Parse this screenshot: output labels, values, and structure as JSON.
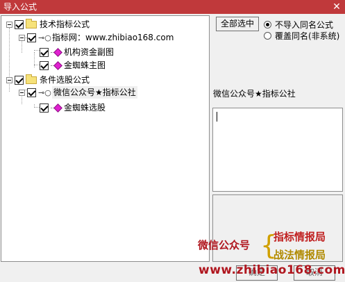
{
  "window": {
    "title": "导入公式",
    "close_glyph": "✕"
  },
  "tree": [
    {
      "label": "技术指标公式",
      "type": "folder",
      "checked": true
    },
    {
      "label": "指标网：www.zhibiao168.com",
      "type": "author",
      "checked": true
    },
    {
      "label": "机构资金副图",
      "type": "formula",
      "checked": true
    },
    {
      "label": "金蜘蛛主图",
      "type": "formula",
      "checked": true
    },
    {
      "label": "条件选股公式",
      "type": "folder",
      "checked": true
    },
    {
      "label": "微信公众号★指标公社",
      "type": "author",
      "checked": true,
      "selected": true
    },
    {
      "label": "金蜘蛛选股",
      "type": "formula",
      "checked": true
    }
  ],
  "select_all_label": "全部选中",
  "options": [
    {
      "label": "不导入同名公式",
      "selected": true
    },
    {
      "label": "覆盖同名(非系统)",
      "selected": false
    }
  ],
  "description_title": "微信公众号★指标公社",
  "watermark": {
    "weixin": "微信公众号",
    "brace": "{",
    "line1": "指标情报局",
    "line2": "战法情报局",
    "url": "www.zhibiao168.com"
  },
  "buttons": {
    "ok": "确定",
    "cancel": "取消"
  }
}
